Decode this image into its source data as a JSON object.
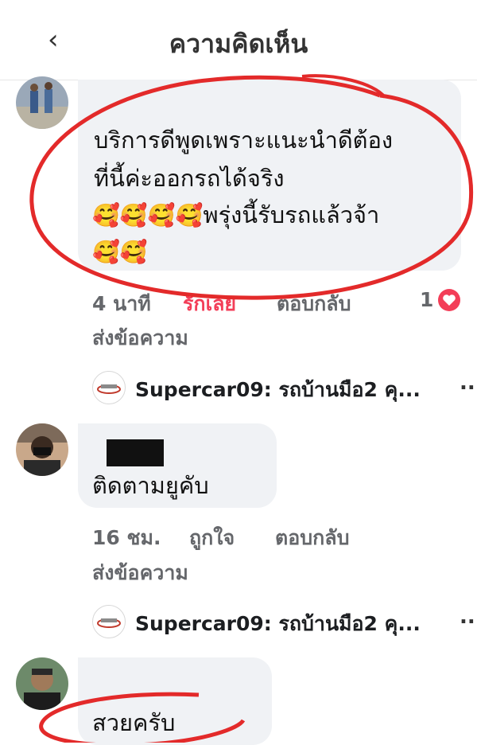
{
  "header": {
    "title": "ความคิดเห็น",
    "back_icon": "‹"
  },
  "comments": [
    {
      "text_line1": "บริการดีพูดเพราะแนะนำดีต้อง",
      "text_line2": "ที่นี้ค่ะออกรถได้จริง",
      "emojis_a": "🥰🥰🥰🥰",
      "text_line3": "พรุ่งนี้รับรถแล้วจ้า",
      "emojis_b": "🥰🥰",
      "time": "4 นาที",
      "like_label": "รักเลย",
      "reply_label": "ตอบกลับ",
      "send_label": "ส่งข้อความ",
      "reaction_count": "1",
      "reply_preview": "Supercar09: รถบ้านมือ2 คุ...",
      "more": "..."
    },
    {
      "text": "ติดตามยูคับ",
      "time": "16 ชม.",
      "like_label": "ถูกใจ",
      "reply_label": "ตอบกลับ",
      "send_label": "ส่งข้อความ",
      "reply_preview": "Supercar09: รถบ้านมือ2 คุ...",
      "more": "..."
    },
    {
      "text": "สวยครับ"
    }
  ],
  "colors": {
    "love_accent": "#f33e58",
    "annotation_red": "#e32a2a",
    "meta_gray": "#65676b",
    "bubble_bg": "#f0f2f5"
  },
  "icons": {
    "back": "chevron-left-icon",
    "reaction": "heart-reaction-icon",
    "more": "more-dots-icon"
  }
}
